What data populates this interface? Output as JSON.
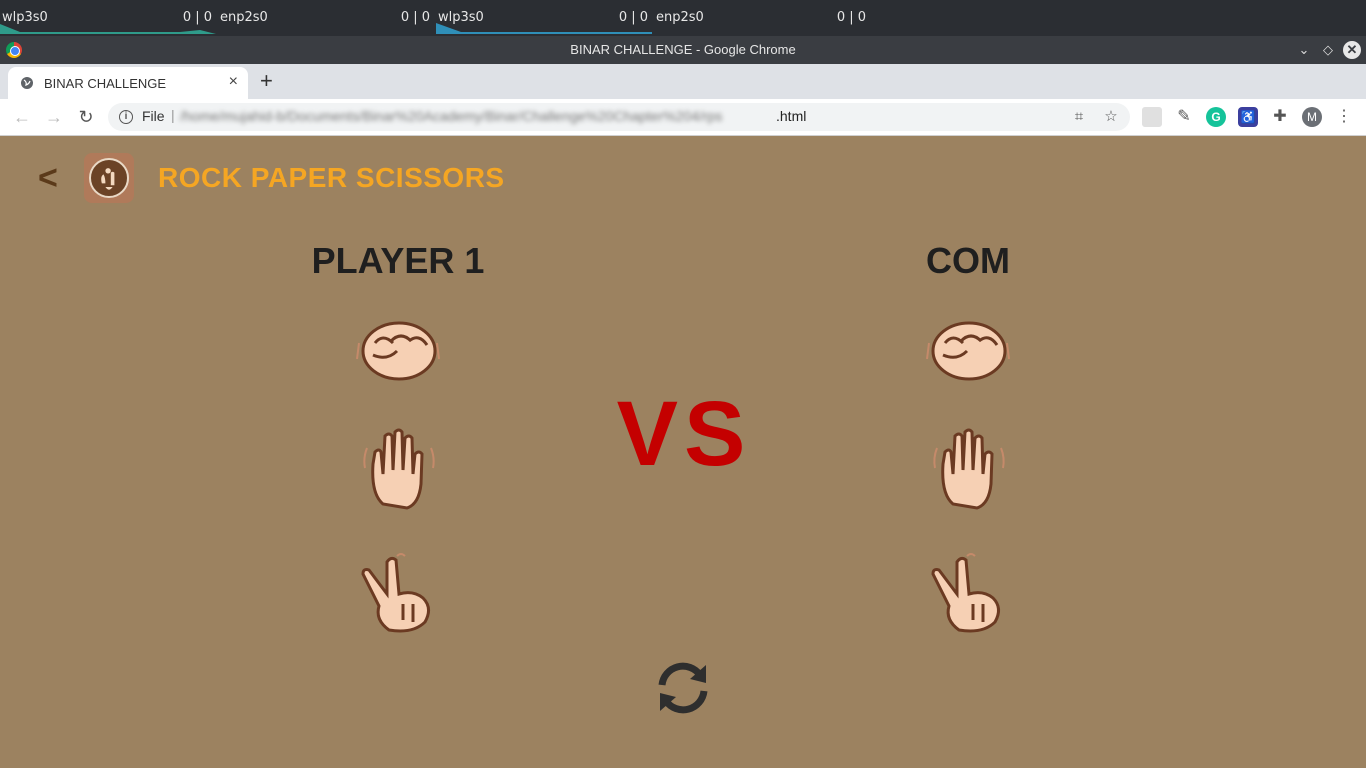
{
  "system_bar": {
    "widgets": [
      {
        "interface": "wlp3s0",
        "value": "0 | 0"
      },
      {
        "interface": "enp2s0",
        "value": "0 | 0"
      },
      {
        "interface": "wlp3s0",
        "value": "0 | 0"
      },
      {
        "interface": "enp2s0",
        "value": "0 | 0"
      }
    ]
  },
  "window": {
    "title": "BINAR CHALLENGE - Google Chrome"
  },
  "tab": {
    "title": "BINAR CHALLENGE",
    "close": "×"
  },
  "toolbar": {
    "scheme_label": "File",
    "url_blurred": "/home/mujahid-b/Documents/Binar%20Academy/Binar/Challenge%20Chapter%204/rps",
    "url_visible_end": ".html",
    "profile_initial": "M"
  },
  "game": {
    "back_label": "<",
    "title": "ROCK PAPER SCISSORS",
    "player_label": "PLAYER 1",
    "com_label": "COM",
    "vs_label": "VS",
    "choices": [
      "rock",
      "paper",
      "scissors"
    ]
  },
  "colors": {
    "page_bg": "#9c8260",
    "title_accent": "#f5a623",
    "vs_color": "#c40000",
    "back_color": "#5b3a1a"
  }
}
